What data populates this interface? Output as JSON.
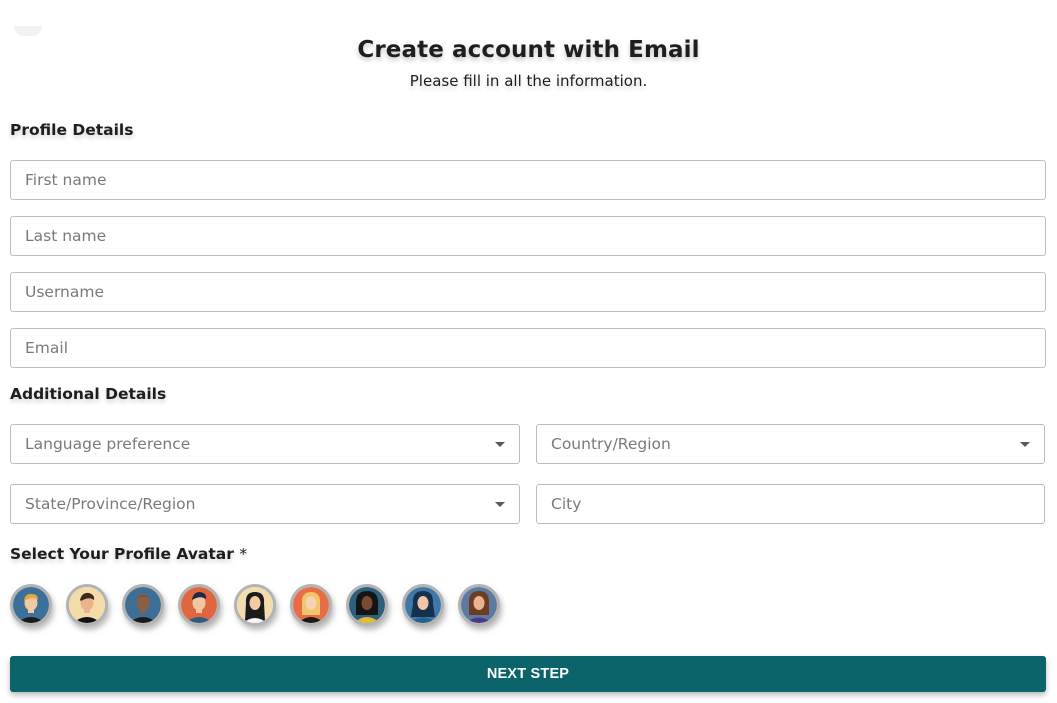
{
  "header": {
    "title": "Create account with Email",
    "subtitle": "Please fill in all the information."
  },
  "profile_details": {
    "heading": "Profile Details",
    "first_name_placeholder": "First name",
    "last_name_placeholder": "Last name",
    "username_placeholder": "Username",
    "email_placeholder": "Email"
  },
  "additional_details": {
    "heading": "Additional Details",
    "language_preference": "Language preference",
    "country_region": "Country/Region",
    "state_province_region": "State/Province/Region",
    "city_placeholder": "City"
  },
  "avatar_section": {
    "heading": "Select Your Profile Avatar",
    "required_mark": "*",
    "avatars": [
      {
        "name": "avatar-1"
      },
      {
        "name": "avatar-2"
      },
      {
        "name": "avatar-3"
      },
      {
        "name": "avatar-4"
      },
      {
        "name": "avatar-5"
      },
      {
        "name": "avatar-6"
      },
      {
        "name": "avatar-7"
      },
      {
        "name": "avatar-8"
      },
      {
        "name": "avatar-9"
      }
    ]
  },
  "actions": {
    "next_step_label": "NEXT STEP"
  },
  "colors": {
    "primary_button": "#0b6469",
    "input_border": "#bdbdbd",
    "avatar_ring": "#b3b3b3"
  }
}
